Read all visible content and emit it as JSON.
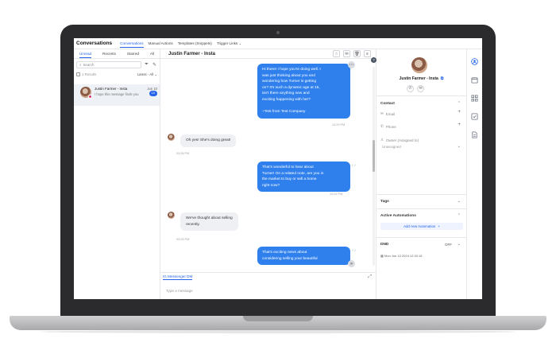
{
  "app": {
    "title": "Conversations",
    "nav_tabs": [
      "Conversations",
      "Manual Actions",
      "Templates (Snippets)",
      "Trigger Links"
    ]
  },
  "inbox": {
    "tabs": [
      "Unread",
      "Recents",
      "Starred",
      "All"
    ],
    "search_placeholder": "Search",
    "select_label": "1 Results",
    "sort_label": "Latest - All"
  },
  "conversation_list": [
    {
      "name": "Justin Farmer - Insta",
      "date": "Jun 10",
      "preview": "I hope this message finds you",
      "unread": "10"
    }
  ],
  "chat": {
    "title": "Justin Farmer - Insta",
    "messages": [
      {
        "direction": "out",
        "lines": [
          "Hi there! I hope you're doing well. I",
          "was just thinking about you and",
          "wondering how Turner is getting",
          "on? It's such a dynamic age at 15,",
          "isn't there anything new and",
          "exciting happening with her?",
          "",
          "~Test from Test Company"
        ],
        "time": "12:29 PM"
      },
      {
        "direction": "in",
        "lines": [
          "Oh yes! She's doing great!"
        ],
        "time": "03:28 PM"
      },
      {
        "direction": "out",
        "lines": [
          "That's wonderful to hear about",
          "Turner! On a related note, are you in",
          "the market to buy or sell a home",
          "right now?"
        ],
        "time": "12:02 PM"
      },
      {
        "direction": "in",
        "lines": [
          "We've thought about selling",
          "recently."
        ],
        "time": "03:28 PM"
      },
      {
        "direction": "out",
        "lines": [
          "That's exciting news about",
          "considering selling your beautiful"
        ],
        "time": ""
      }
    ],
    "channel_tab": "IG Messenger DM",
    "composer_placeholder": "Type a message"
  },
  "contact": {
    "name": "Justin Farmer - Insta",
    "sections": {
      "contact_title": "Contact",
      "email_label": "Email",
      "phone_label": "Phone",
      "owner_label": "Owner (Assigned to)",
      "owner_value": "Unassigned",
      "tags_title": "Tags",
      "automations_title": "Active Automations",
      "add_automation": "Add new Automation",
      "dnd_title": "DND",
      "dnd_value": "OFF",
      "dnd_date": "Mon Jun 10 2024 12:32:15"
    }
  },
  "icons": {
    "rail": [
      "user-icon",
      "calendar-icon",
      "grid-icon",
      "checkbox-icon",
      "document-icon"
    ]
  },
  "colors": {
    "accent": "#2563eb",
    "bubble_out": "#2f80ed",
    "bubble_in": "#eef0f4",
    "laptop_frame": "#2b2b2d"
  }
}
